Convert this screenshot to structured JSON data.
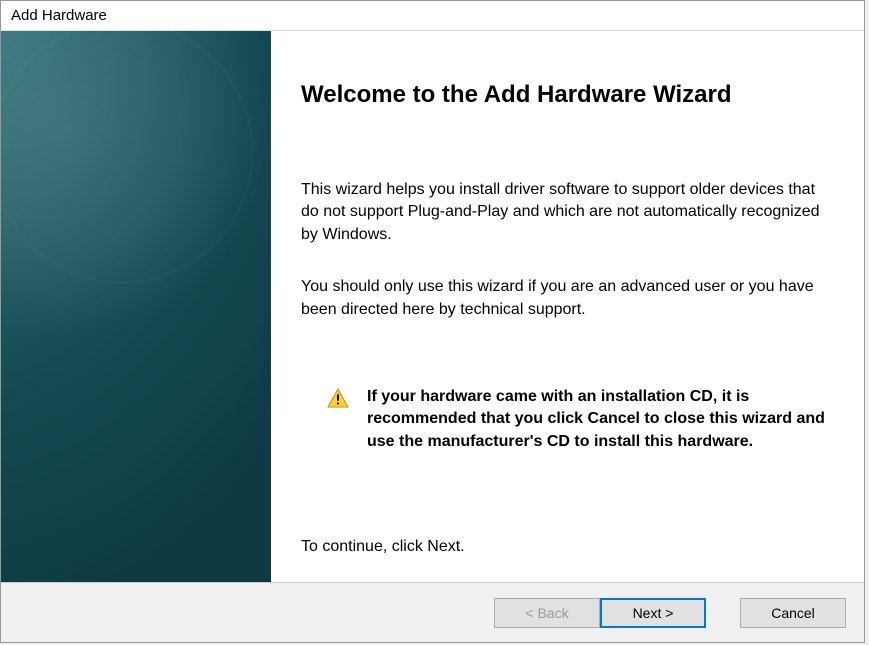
{
  "window": {
    "title": "Add Hardware"
  },
  "content": {
    "heading": "Welcome to the Add Hardware Wizard",
    "para1": "This wizard helps you install driver software to support older devices that do not support Plug-and-Play and which are not automatically recognized by Windows.",
    "para2": "You should only use this wizard if you are an advanced user or you have been directed here by technical support.",
    "warning": "If your hardware came with an installation CD, it is recommended that you click Cancel to close this wizard and use the manufacturer's CD to install this hardware.",
    "continue": "To continue, click Next."
  },
  "buttons": {
    "back": "< Back",
    "next": "Next >",
    "cancel": "Cancel"
  }
}
